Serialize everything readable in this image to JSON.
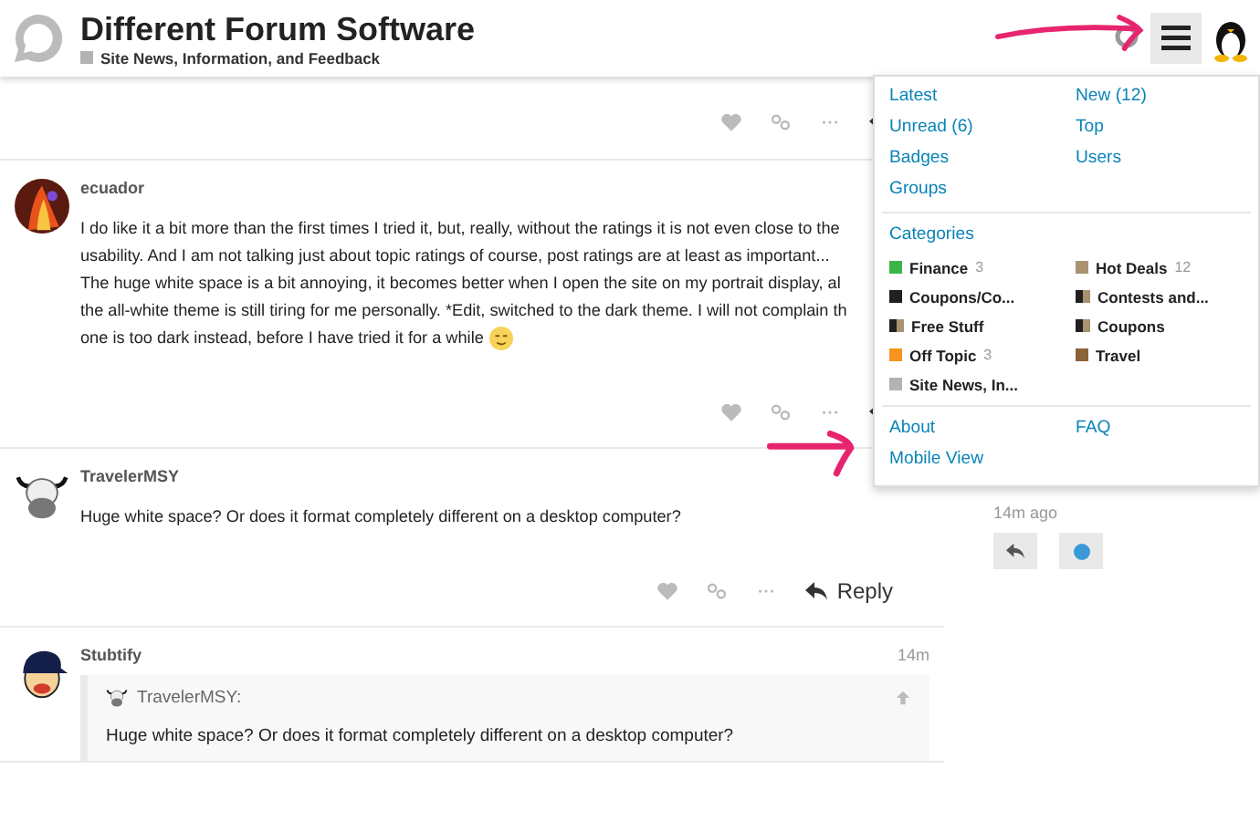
{
  "header": {
    "title": "Different Forum Software",
    "category": "Site News, Information, and Feedback"
  },
  "posts": [
    {
      "kind": "actions-only"
    },
    {
      "kind": "post",
      "author": "ecuador",
      "lines": [
        "I do like it a bit more than the first times I tried it, but, really, without the ratings it is not even close to the",
        "usability. And I am not talking just about topic ratings of course, post ratings are at least as important...",
        "The huge white space is a bit annoying, it becomes better when I open the site on my portrait display, al",
        "the all-white theme is still tiring for me personally. *Edit, switched to the dark theme. I will not complain th",
        "one is too dark instead, before I have tried it for a while"
      ],
      "emoji": true
    },
    {
      "kind": "post",
      "author": "TravelerMSY",
      "lines": [
        "Huge white space? Or does it format completely different on a desktop computer?"
      ],
      "reply_label": "Reply"
    },
    {
      "kind": "post",
      "author": "Stubtify",
      "time": "14m",
      "quote": {
        "author": "TravelerMSY:",
        "text": "Huge white space? Or does it format completely different on a desktop computer?"
      }
    }
  ],
  "timeline": {
    "time": "14m ago"
  },
  "menu": {
    "links": [
      "Latest",
      "New (12)",
      "Unread (6)",
      "Top",
      "Badges",
      "Users",
      "Groups"
    ],
    "categories_label": "Categories",
    "categories": [
      {
        "name": "Finance",
        "count": "3",
        "color": "#3ab54a"
      },
      {
        "name": "Hot Deals",
        "count": "12",
        "color": "#a89270"
      },
      {
        "name": "Coupons/Co...",
        "color": "#231f20"
      },
      {
        "name": "Contests and...",
        "stripes": [
          {
            "color": "#231f20"
          },
          {
            "color": "#a89270"
          }
        ]
      },
      {
        "name": "Free Stuff",
        "stripes": [
          {
            "color": "#231f20"
          },
          {
            "color": "#a89270"
          }
        ]
      },
      {
        "name": "Coupons",
        "stripes": [
          {
            "color": "#231f20"
          },
          {
            "color": "#a89270"
          }
        ]
      },
      {
        "name": "Off Topic",
        "count": "3",
        "color": "#f7941d"
      },
      {
        "name": "Travel",
        "color": "#8c6238"
      },
      {
        "name": "Site News, In...",
        "color": "#b3b3b3"
      }
    ],
    "footer_links": [
      "About",
      "FAQ",
      "Mobile View"
    ]
  }
}
